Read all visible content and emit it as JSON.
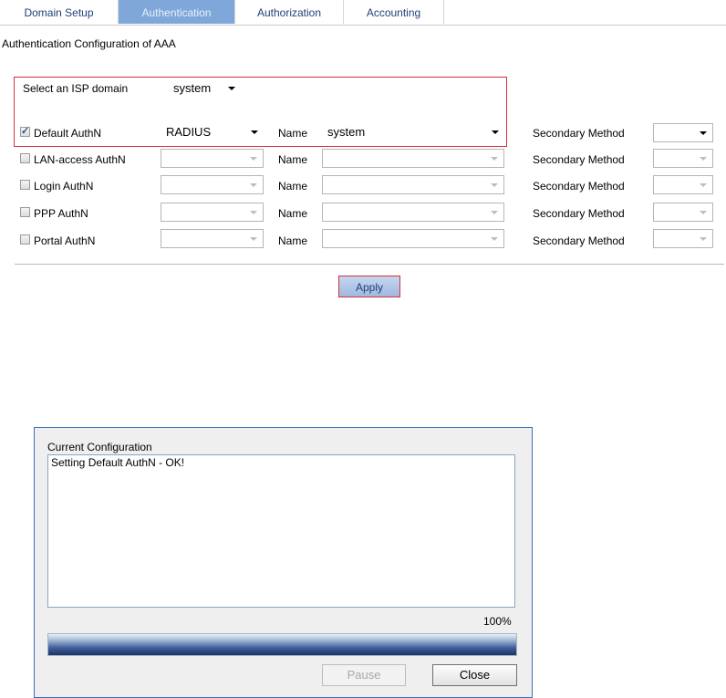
{
  "tabs": [
    {
      "label": "Domain Setup",
      "active": false
    },
    {
      "label": "Authentication",
      "active": true
    },
    {
      "label": "Authorization",
      "active": false
    },
    {
      "label": "Accounting",
      "active": false
    }
  ],
  "page_title": "Authentication Configuration of AAA",
  "isp": {
    "label": "Select an ISP domain",
    "value": "system"
  },
  "rows": [
    {
      "label": "Default AuthN",
      "checked": true,
      "method": "RADIUS",
      "name_label": "Name",
      "name_value": "system",
      "secondary_label": "Secondary Method",
      "secondary_value": ""
    },
    {
      "label": "LAN-access AuthN",
      "checked": false,
      "method": "",
      "name_label": "Name",
      "name_value": "",
      "secondary_label": "Secondary Method",
      "secondary_value": ""
    },
    {
      "label": "Login AuthN",
      "checked": false,
      "method": "",
      "name_label": "Name",
      "name_value": "",
      "secondary_label": "Secondary Method",
      "secondary_value": ""
    },
    {
      "label": "PPP AuthN",
      "checked": false,
      "method": "",
      "name_label": "Name",
      "name_value": "",
      "secondary_label": "Secondary Method",
      "secondary_value": ""
    },
    {
      "label": "Portal AuthN",
      "checked": false,
      "method": "",
      "name_label": "Name",
      "name_value": "",
      "secondary_label": "Secondary Method",
      "secondary_value": ""
    }
  ],
  "apply_label": "Apply",
  "dialog": {
    "title": "Current Configuration",
    "log": "Setting Default AuthN - OK!",
    "progress_text": "100%",
    "progress": 1.0,
    "pause_label": "Pause",
    "close_label": "Close"
  }
}
